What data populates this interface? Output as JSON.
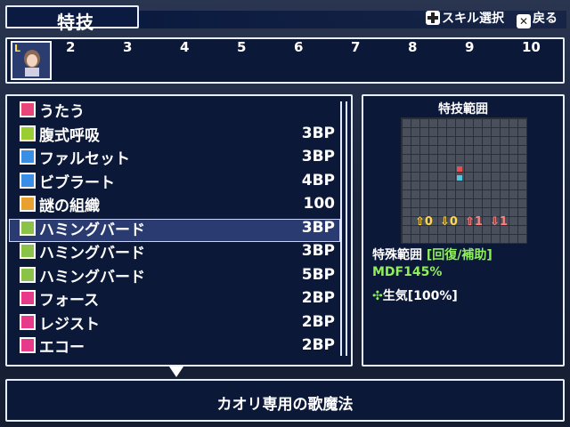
{
  "header": {
    "title": "特技"
  },
  "hints": {
    "skill_select": "スキル選択",
    "back": "戻る"
  },
  "party": {
    "leader_badge": "L",
    "slots": [
      "2",
      "3",
      "4",
      "5",
      "6",
      "7",
      "8",
      "9",
      "10"
    ]
  },
  "skills": [
    {
      "name": "うたう",
      "cost": "",
      "icon": "music-note-icon",
      "color": "#e8457a"
    },
    {
      "name": "腹式呼吸",
      "cost": "3BP",
      "icon": "plus-icon",
      "color": "#9acd32"
    },
    {
      "name": "ファルセット",
      "cost": "3BP",
      "icon": "square-icon",
      "color": "#3a8ee6"
    },
    {
      "name": "ビブラート",
      "cost": "4BP",
      "icon": "square-icon",
      "color": "#3a8ee6"
    },
    {
      "name": "謎の組織",
      "cost": "100",
      "icon": "dots-icon",
      "color": "#e8a030"
    },
    {
      "name": "ハミングバード",
      "cost": "3BP",
      "icon": "note-icon",
      "color": "#8bc34a"
    },
    {
      "name": "ハミングバード",
      "cost": "3BP",
      "icon": "plus-one-icon",
      "color": "#8bc34a"
    },
    {
      "name": "ハミングバード",
      "cost": "5BP",
      "icon": "plus-two-icon",
      "color": "#8bc34a"
    },
    {
      "name": "フォース",
      "cost": "2BP",
      "icon": "lv-icon",
      "color": "#e83a8a"
    },
    {
      "name": "レジスト",
      "cost": "2BP",
      "icon": "lv-icon",
      "color": "#e83a8a"
    },
    {
      "name": "エコー",
      "cost": "2BP",
      "icon": "lv-icon",
      "color": "#e83a8a"
    }
  ],
  "selected_index": 5,
  "range": {
    "title": "特技範囲",
    "arrows": [
      "0",
      "0",
      "1",
      "1"
    ],
    "special_range_label": "特殊範囲",
    "special_range_type": "[回復/補助]",
    "mdf": "MDF145%",
    "effect": "生気[100%]"
  },
  "description": "カオリ専用の歌魔法",
  "colors": {
    "accent_green": "#8fef5a",
    "panel": "#0b1838"
  }
}
